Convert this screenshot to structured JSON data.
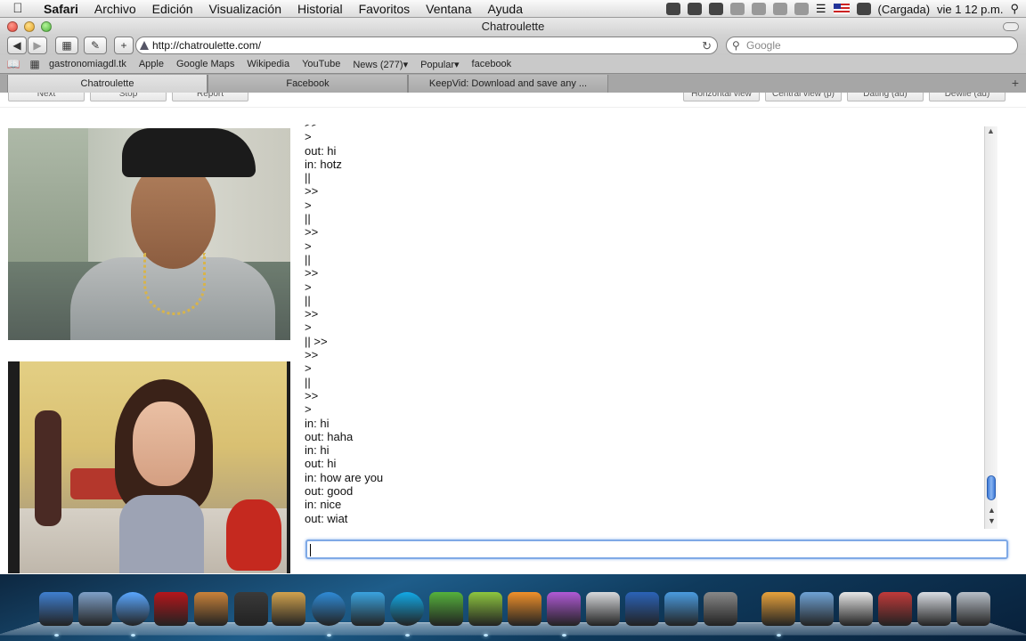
{
  "menubar": {
    "app_name": "Safari",
    "items": [
      "Archivo",
      "Edición",
      "Visualización",
      "Historial",
      "Favoritos",
      "Ventana",
      "Ayuda"
    ],
    "battery_label": "(Cargada)",
    "clock": "vie 1 12 p.m."
  },
  "window": {
    "title": "Chatroulette"
  },
  "toolbar": {
    "url": "http://chatroulette.com/",
    "search_placeholder": "Google"
  },
  "bookmarks": [
    "gastronomiagdl.tk",
    "Apple",
    "Google Maps",
    "Wikipedia",
    "YouTube",
    "News (277)▾",
    "Popular▾",
    "facebook"
  ],
  "tabs": [
    {
      "label": "Chatroulette",
      "active": true
    },
    {
      "label": "Facebook",
      "active": false
    },
    {
      "label": "KeepVid: Download and save any ...",
      "active": false
    }
  ],
  "page": {
    "buttons": [
      "Next",
      "Stop",
      "Report",
      "Horizontal view",
      "Central view (p)",
      "Dating (ad)",
      "Dewile (ad)"
    ],
    "chat_lines": [
      ">>",
      ">",
      "out: hi",
      "in: hotz",
      "||",
      ">>",
      ">",
      "||",
      ">>",
      ">",
      "||",
      ">>",
      ">",
      "||",
      ">>",
      ">",
      "|| >>",
      ">>",
      ">",
      "||",
      ">>",
      ">",
      "in: hi",
      "out: haha",
      "in: hi",
      "out: hi",
      "in: how are you",
      "out: good",
      "in: nice",
      "out: wiat"
    ],
    "chat_input_value": ""
  },
  "dock": {
    "icons": [
      {
        "name": "finder",
        "color": "#3f7fd0"
      },
      {
        "name": "mail-bird",
        "color": "#7fa0c8"
      },
      {
        "name": "ichat",
        "color": "#5aa7ff"
      },
      {
        "name": "photo-booth",
        "color": "#b5161b"
      },
      {
        "name": "iphoto",
        "color": "#c9823a"
      },
      {
        "name": "imovie",
        "color": "#3a3a3a"
      },
      {
        "name": "garageband",
        "color": "#d1a24e"
      },
      {
        "name": "safari",
        "color": "#2f8bd7"
      },
      {
        "name": "messenger-w",
        "color": "#3aa3e0"
      },
      {
        "name": "skype",
        "color": "#12a9e6"
      },
      {
        "name": "adium",
        "color": "#55b13c"
      },
      {
        "name": "msn",
        "color": "#8dc63f"
      },
      {
        "name": "p-app",
        "color": "#f0902a"
      },
      {
        "name": "e-app",
        "color": "#b05ad6"
      },
      {
        "name": "books",
        "color": "#d7d9dc"
      },
      {
        "name": "photoshop-doc",
        "color": "#2b63b8"
      },
      {
        "name": "msn-buddies",
        "color": "#4a9be0"
      },
      {
        "name": "video-converter",
        "color": "#888"
      },
      {
        "name": "flv-doc",
        "color": "#e8a23c"
      },
      {
        "name": "folder",
        "color": "#6fa3d6"
      },
      {
        "name": "dock-doc",
        "color": "#e7e7e7"
      },
      {
        "name": "network-app",
        "color": "#c03a3a"
      },
      {
        "name": "preview",
        "color": "#d9dde3"
      },
      {
        "name": "trash",
        "color": "#b8bfc8"
      }
    ]
  }
}
